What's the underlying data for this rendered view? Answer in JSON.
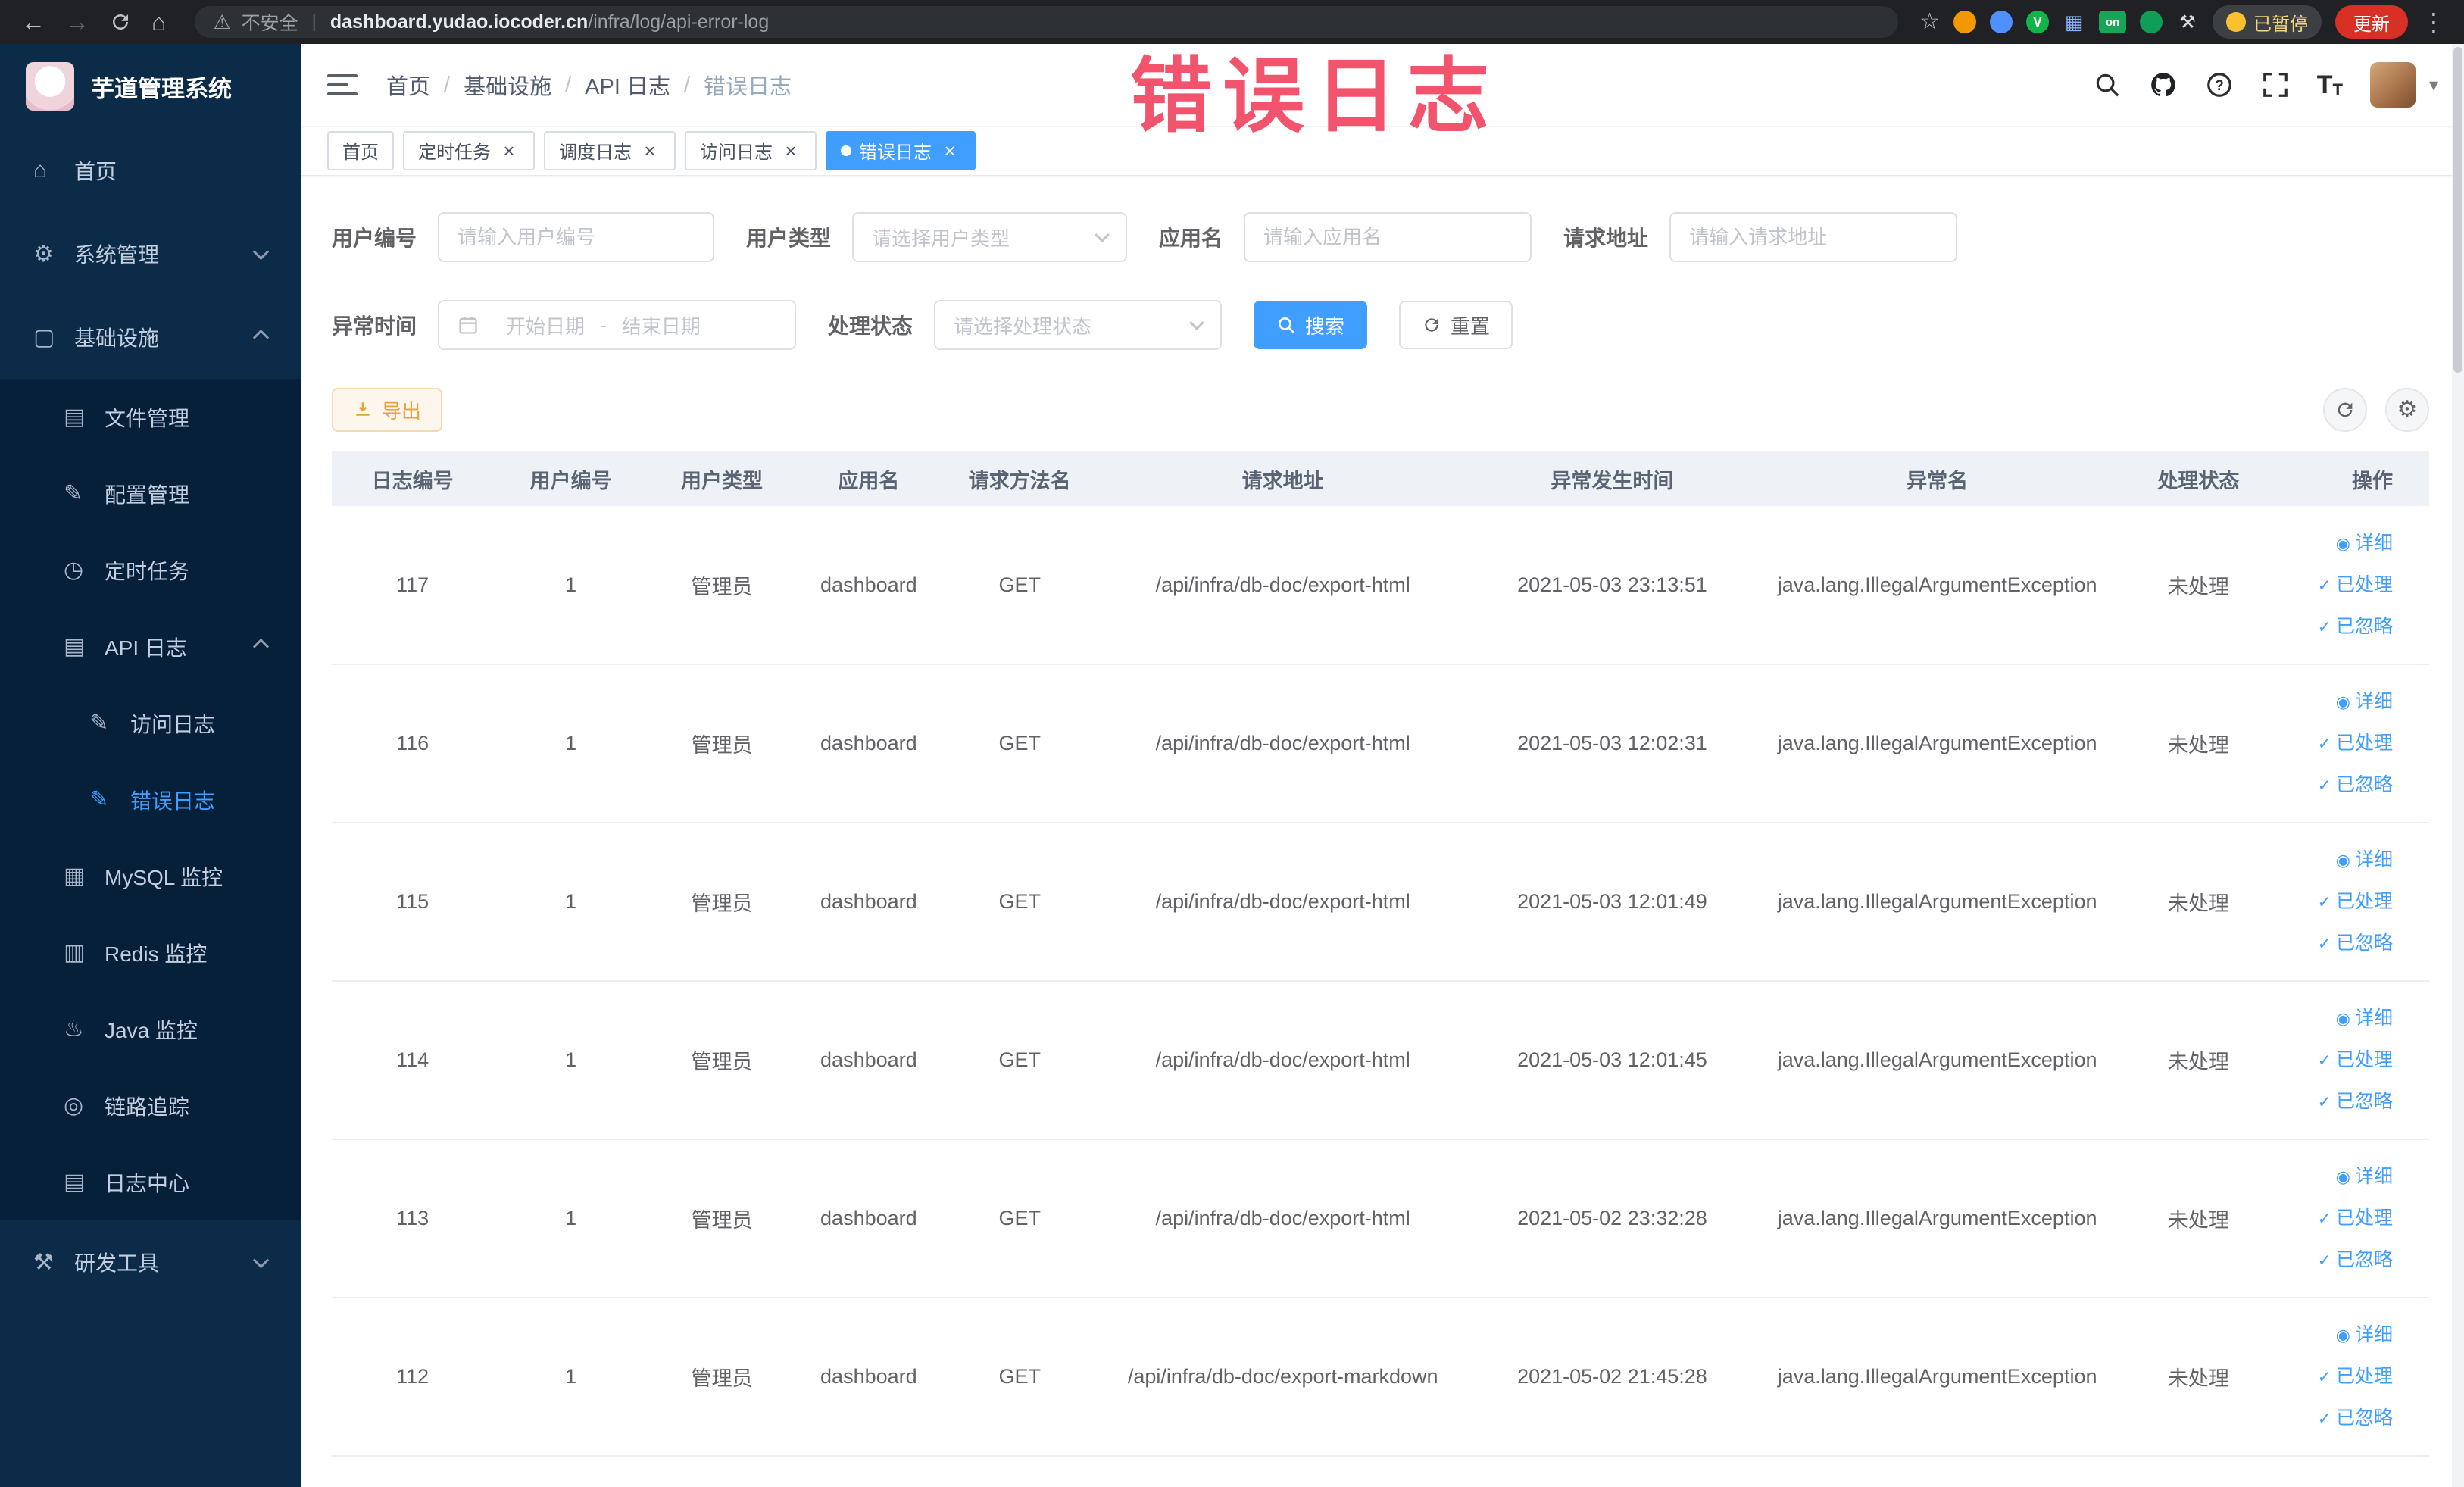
{
  "browser": {
    "security_label": "不安全",
    "url_host": "dashboard.yudao.iocoder.cn",
    "url_path": "/infra/log/api-error-log",
    "paused_badge": "已暂停",
    "update_label": "更新"
  },
  "watermark": {
    "text": "错误日志",
    "color": "#f2546d"
  },
  "icons": {
    "eye": "◉",
    "check": "✓",
    "close": "×"
  },
  "sidebar": {
    "logo_title": "芋道管理系统",
    "menu": [
      {
        "key": "home",
        "label": "首页",
        "icon": "home-icon",
        "level": 0,
        "sub": false
      },
      {
        "key": "system",
        "label": "系统管理",
        "icon": "gear-icon",
        "level": 0,
        "sub": false,
        "expand": "down"
      },
      {
        "key": "infra",
        "label": "基础设施",
        "icon": "infra-icon",
        "level": 0,
        "sub": false,
        "expand": "up"
      },
      {
        "key": "file",
        "label": "文件管理",
        "icon": "file-icon",
        "level": 1,
        "sub": true
      },
      {
        "key": "config",
        "label": "配置管理",
        "icon": "edit-icon",
        "level": 1,
        "sub": true
      },
      {
        "key": "job",
        "label": "定时任务",
        "icon": "clock-icon",
        "level": 1,
        "sub": true
      },
      {
        "key": "api-log",
        "label": "API 日志",
        "icon": "document-icon",
        "level": 1,
        "sub": true,
        "expand": "up"
      },
      {
        "key": "access-log",
        "label": "访问日志",
        "icon": "doc-edit-icon",
        "level": 2,
        "sub": true
      },
      {
        "key": "error-log",
        "label": "错误日志",
        "icon": "doc-edit-icon",
        "level": 2,
        "sub": true,
        "active": true
      },
      {
        "key": "mysql",
        "label": "MySQL 监控",
        "icon": "grid-icon",
        "level": 1,
        "sub": true
      },
      {
        "key": "redis",
        "label": "Redis 监控",
        "icon": "layers-icon",
        "level": 1,
        "sub": true
      },
      {
        "key": "java",
        "label": "Java 监控",
        "icon": "coffee-icon",
        "level": 1,
        "sub": true
      },
      {
        "key": "trace",
        "label": "链路追踪",
        "icon": "trace-icon",
        "level": 1,
        "sub": true
      },
      {
        "key": "log-center",
        "label": "日志中心",
        "icon": "file-icon",
        "level": 1,
        "sub": true
      },
      {
        "key": "tools",
        "label": "研发工具",
        "icon": "tools-icon",
        "level": 0,
        "sub": false,
        "expand": "down"
      }
    ]
  },
  "breadcrumb": [
    "首页",
    "基础设施",
    "API 日志",
    "错误日志"
  ],
  "tabs": [
    {
      "key": "home",
      "label": "首页",
      "closable": false,
      "active": false
    },
    {
      "key": "job",
      "label": "定时任务",
      "closable": true,
      "active": false
    },
    {
      "key": "job-log",
      "label": "调度日志",
      "closable": true,
      "active": false
    },
    {
      "key": "access-log",
      "label": "访问日志",
      "closable": true,
      "active": false
    },
    {
      "key": "error-log",
      "label": "错误日志",
      "closable": true,
      "active": true
    }
  ],
  "filters": {
    "user_id": {
      "label": "用户编号",
      "placeholder": "请输入用户编号"
    },
    "user_type": {
      "label": "用户类型",
      "placeholder": "请选择用户类型"
    },
    "app_name": {
      "label": "应用名",
      "placeholder": "请输入应用名"
    },
    "request_url": {
      "label": "请求地址",
      "placeholder": "请输入请求地址"
    },
    "exception_time": {
      "label": "异常时间",
      "start_placeholder": "开始日期",
      "separator": "-",
      "end_placeholder": "结束日期"
    },
    "process_status": {
      "label": "处理状态",
      "placeholder": "请选择处理状态"
    },
    "search_label": "搜索",
    "reset_label": "重置"
  },
  "toolbar": {
    "export_label": "导出"
  },
  "table": {
    "columns": [
      "日志编号",
      "用户编号",
      "用户类型",
      "应用名",
      "请求方法名",
      "请求地址",
      "异常发生时间",
      "异常名",
      "处理状态",
      "操作"
    ],
    "ops": [
      "详细",
      "已处理",
      "已忽略"
    ],
    "rows": [
      {
        "id": "117",
        "user_id": "1",
        "user_type": "管理员",
        "app": "dashboard",
        "method": "GET",
        "url": "/api/infra/db-doc/export-html",
        "time": "2021-05-03 23:13:51",
        "exception": "java.lang.IllegalArgumentException",
        "status": "未处理"
      },
      {
        "id": "116",
        "user_id": "1",
        "user_type": "管理员",
        "app": "dashboard",
        "method": "GET",
        "url": "/api/infra/db-doc/export-html",
        "time": "2021-05-03 12:02:31",
        "exception": "java.lang.IllegalArgumentException",
        "status": "未处理"
      },
      {
        "id": "115",
        "user_id": "1",
        "user_type": "管理员",
        "app": "dashboard",
        "method": "GET",
        "url": "/api/infra/db-doc/export-html",
        "time": "2021-05-03 12:01:49",
        "exception": "java.lang.IllegalArgumentException",
        "status": "未处理"
      },
      {
        "id": "114",
        "user_id": "1",
        "user_type": "管理员",
        "app": "dashboard",
        "method": "GET",
        "url": "/api/infra/db-doc/export-html",
        "time": "2021-05-03 12:01:45",
        "exception": "java.lang.IllegalArgumentException",
        "status": "未处理"
      },
      {
        "id": "113",
        "user_id": "1",
        "user_type": "管理员",
        "app": "dashboard",
        "method": "GET",
        "url": "/api/infra/db-doc/export-html",
        "time": "2021-05-02 23:32:28",
        "exception": "java.lang.IllegalArgumentException",
        "status": "未处理"
      },
      {
        "id": "112",
        "user_id": "1",
        "user_type": "管理员",
        "app": "dashboard",
        "method": "GET",
        "url": "/api/infra/db-doc/export-markdown",
        "time": "2021-05-02 21:45:28",
        "exception": "java.lang.IllegalArgumentException",
        "status": "未处理"
      }
    ]
  }
}
